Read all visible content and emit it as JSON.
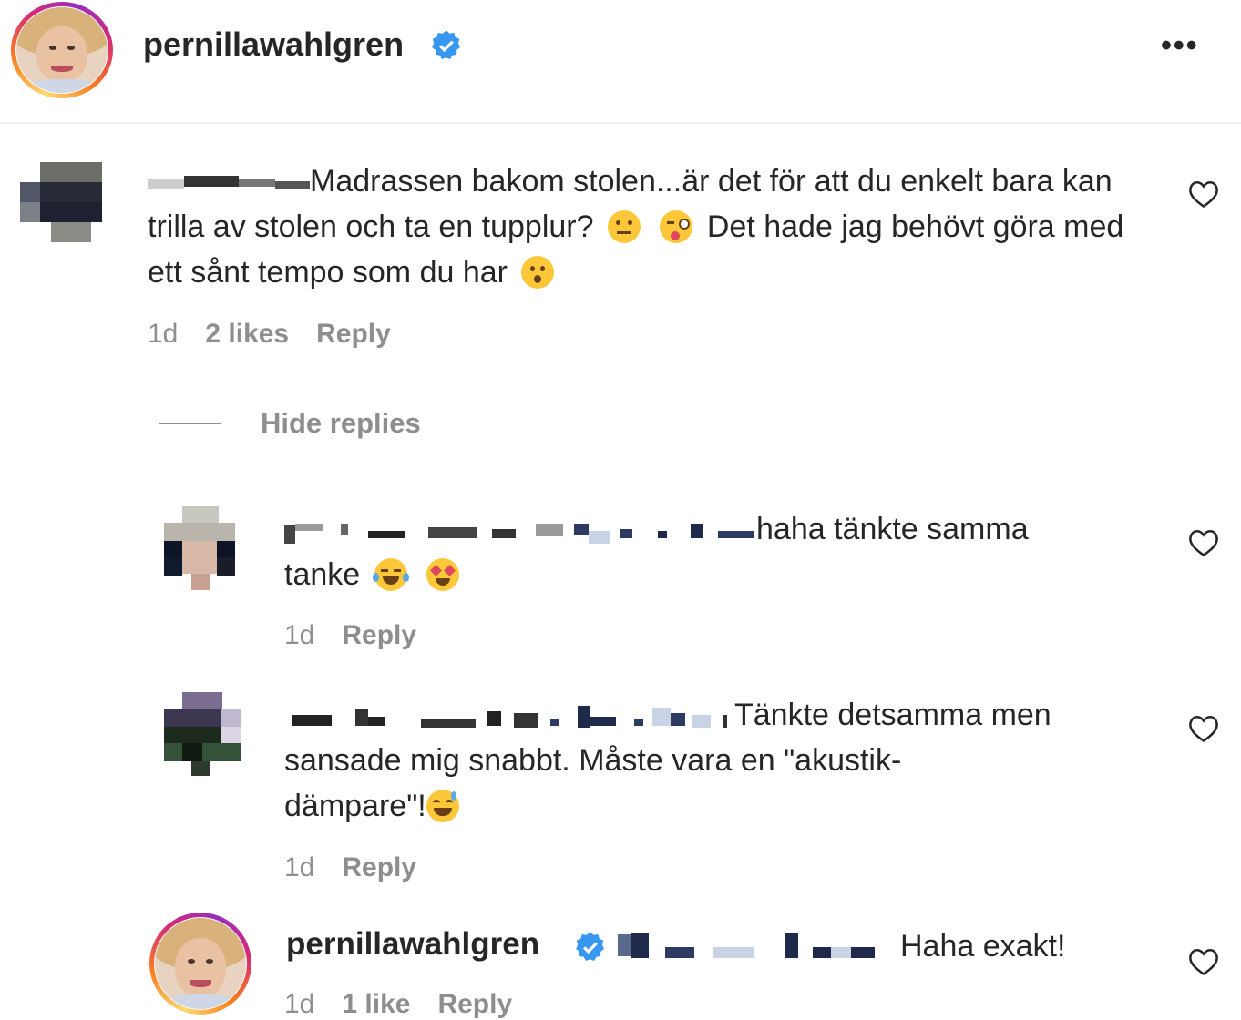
{
  "header": {
    "username": "pernillawahlgren",
    "more_icon": "more-horizontal-icon"
  },
  "comments": [
    {
      "text": "Madrassen bakom stolen...är det för att du enkelt bara kan trilla av stolen och ta en tupplur?",
      "text_after_emojis": "Det hade jag behövt göra med ett sånt tempo som du har",
      "time": "1d",
      "likes": "2 likes",
      "reply": "Reply"
    }
  ],
  "hide_replies": "Hide replies",
  "replies": [
    {
      "text_line1": "haha tänkte samma",
      "text_line2": "tanke",
      "time": "1d",
      "reply": "Reply"
    },
    {
      "text_line1": "Tänkte detsamma men",
      "text_line2": "sansade mig snabbt. Måste vara en \"akustik-",
      "text_line3": "dämpare\"!",
      "time": "1d",
      "reply": "Reply"
    },
    {
      "username": "pernillawahlgren",
      "text": "Haha exakt!",
      "time": "1d",
      "likes": "1 like",
      "reply": "Reply"
    }
  ],
  "colors": {
    "verified": "#3897f0",
    "muted": "#8e8e8e",
    "text": "#262626"
  }
}
